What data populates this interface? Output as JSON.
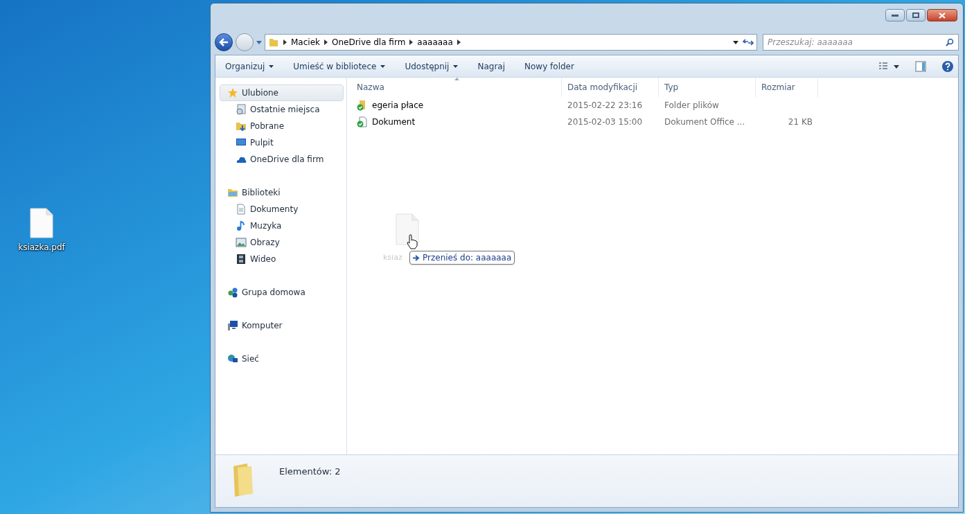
{
  "desktop": {
    "icons": [
      {
        "label": "ksiazka.pdf"
      }
    ]
  },
  "window": {
    "address": {
      "crumbs": [
        "Maciek",
        "OneDrive dla firm",
        "aaaaaaa"
      ]
    },
    "search": {
      "placeholder": "Przeszukaj: aaaaaaa"
    },
    "toolbar": [
      {
        "label": "Organizuj",
        "dropdown": true
      },
      {
        "label": "Umieść w bibliotece",
        "dropdown": true
      },
      {
        "label": "Udostępnij",
        "dropdown": true
      },
      {
        "label": "Nagraj",
        "dropdown": false
      },
      {
        "label": "Nowy folder",
        "dropdown": false
      }
    ],
    "sidebar": {
      "groups": [
        {
          "label": "Ulubione",
          "kind": "star",
          "selected": true,
          "children": [
            {
              "label": "Ostatnie miejsca",
              "kind": "recent",
              "selected": false
            },
            {
              "label": "Pobrane",
              "kind": "download",
              "selected": false
            },
            {
              "label": "Pulpit",
              "kind": "desktop",
              "selected": false
            },
            {
              "label": "OneDrive dla firm",
              "kind": "cloud",
              "selected": false
            }
          ]
        },
        {
          "label": "Biblioteki",
          "kind": "library",
          "selected": false,
          "children": [
            {
              "label": "Dokumenty",
              "kind": "doc",
              "selected": false
            },
            {
              "label": "Muzyka",
              "kind": "music",
              "selected": false
            },
            {
              "label": "Obrazy",
              "kind": "picture",
              "selected": false
            },
            {
              "label": "Wideo",
              "kind": "video",
              "selected": false
            }
          ]
        },
        {
          "label": "Grupa domowa",
          "kind": "homegroup",
          "selected": false
        },
        {
          "label": "Komputer",
          "kind": "computer",
          "selected": false
        },
        {
          "label": "Sieć",
          "kind": "network",
          "selected": false
        }
      ]
    },
    "table": {
      "columns": [
        {
          "label": "Nazwa",
          "sorted": true
        },
        {
          "label": "Data modyfikacji",
          "sorted": false
        },
        {
          "label": "Typ",
          "sorted": false
        },
        {
          "label": "Rozmiar",
          "sorted": false
        }
      ],
      "rows": [
        {
          "kind": "folder",
          "name": "egeria płace",
          "date": "2015-02-22 23:16",
          "type": "Folder plików"
        },
        {
          "kind": "document",
          "name": "Dokument",
          "date": "2015-02-03 15:00",
          "type": "Dokument Office ...",
          "size": "21 KB"
        }
      ]
    },
    "drag": {
      "label": "ksiaz",
      "tooltip": "Przenieś do: aaaaaaa"
    },
    "status_bar": {
      "text": "Elementów: 2"
    }
  }
}
